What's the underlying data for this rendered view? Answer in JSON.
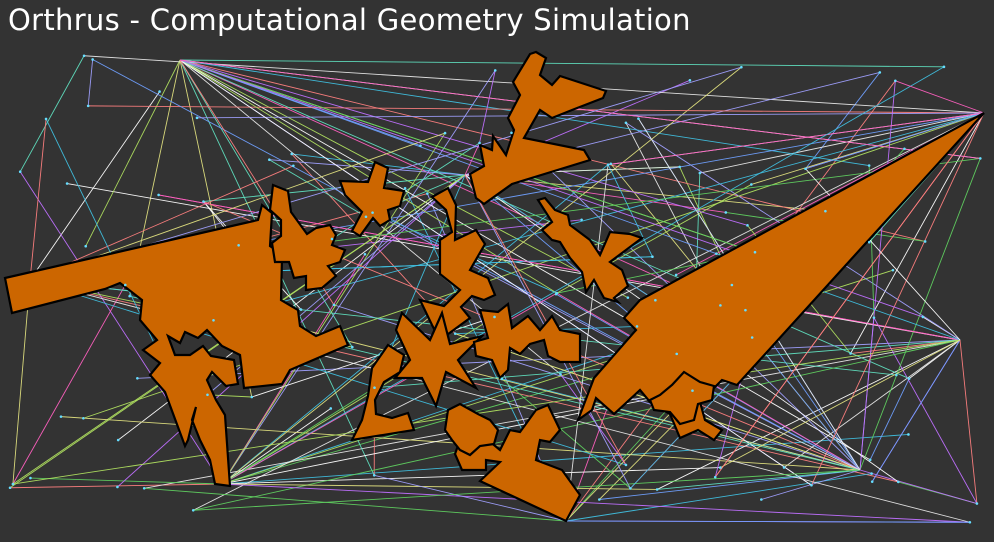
{
  "window": {
    "title": "Orthrus - Computational Geometry Simulation"
  },
  "colors": {
    "background": "#333333",
    "obstacle_fill": "#cc6600",
    "obstacle_stroke": "#000000",
    "title_text": "#ffffff",
    "edge_palette": [
      "#e8e8e8",
      "#b0e060",
      "#60e0c0",
      "#c070ff",
      "#ff60c0",
      "#e0e080",
      "#70a0ff",
      "#60d060",
      "#ff8080",
      "#ffffff",
      "#a0a0ff",
      "#40c0e0"
    ]
  },
  "scene": {
    "obstacle_count": 13,
    "graph_edges_drawn": true
  }
}
